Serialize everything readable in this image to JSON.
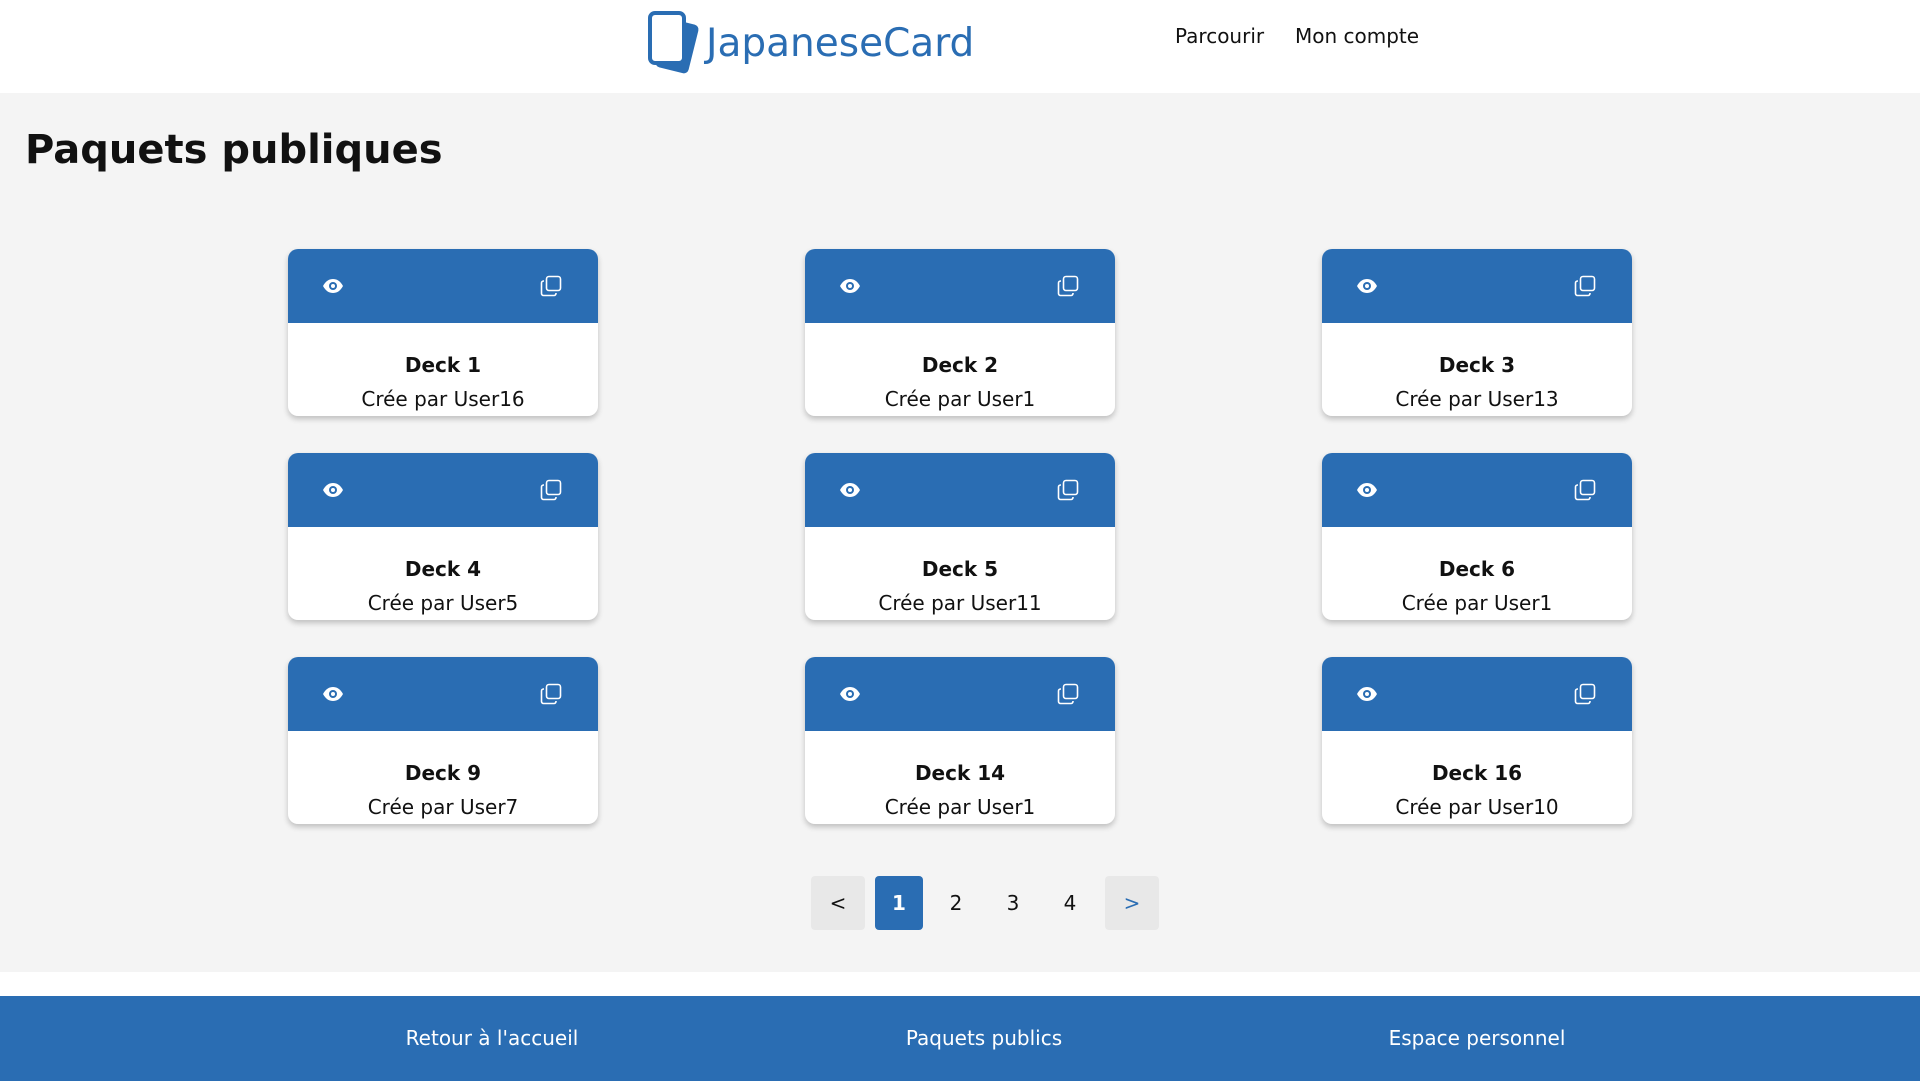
{
  "header": {
    "brand": "JapaneseCard",
    "nav": [
      {
        "label": "Parcourir"
      },
      {
        "label": "Mon compte"
      }
    ]
  },
  "main": {
    "title": "Paquets publiques",
    "decks": [
      {
        "name": "Deck 1",
        "author": "Crée par User16"
      },
      {
        "name": "Deck 2",
        "author": "Crée par User1"
      },
      {
        "name": "Deck 3",
        "author": "Crée par User13"
      },
      {
        "name": "Deck 4",
        "author": "Crée par User5"
      },
      {
        "name": "Deck 5",
        "author": "Crée par User11"
      },
      {
        "name": "Deck 6",
        "author": "Crée par User1"
      },
      {
        "name": "Deck 9",
        "author": "Crée par User7"
      },
      {
        "name": "Deck 14",
        "author": "Crée par User1"
      },
      {
        "name": "Deck 16",
        "author": "Crée par User10"
      }
    ],
    "card_icons": {
      "view": "eye-icon",
      "copy": "copy-icon"
    }
  },
  "pagination": {
    "prev": "<",
    "pages": [
      "1",
      "2",
      "3",
      "4"
    ],
    "current": "1",
    "next": ">"
  },
  "footer": {
    "links": [
      {
        "label": "Retour à l'accueil"
      },
      {
        "label": "Paquets publics"
      },
      {
        "label": "Espace personnel"
      }
    ]
  },
  "colors": {
    "primary": "#2a6db3",
    "background": "#f4f4f4",
    "surface": "#ffffff"
  }
}
